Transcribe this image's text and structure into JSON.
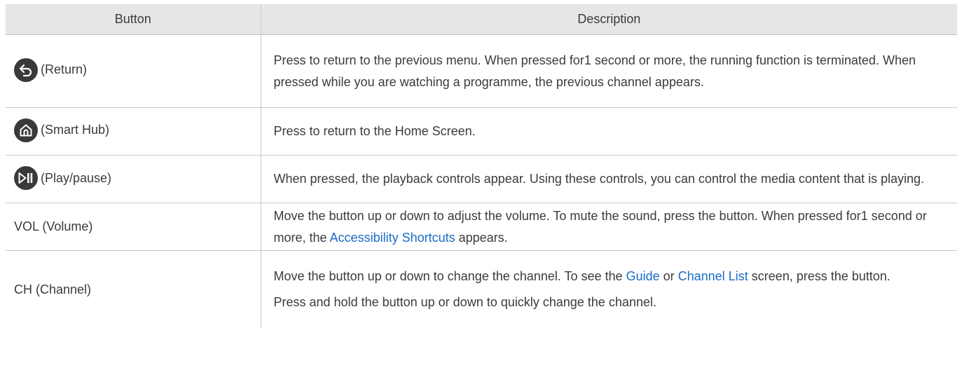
{
  "header": {
    "button": "Button",
    "description": "Description"
  },
  "rows": {
    "return": {
      "icon": "return-icon",
      "label": "(Return)",
      "desc": "Press to return to the previous menu. When pressed for1 second or more, the running function is terminated. When pressed while you are watching a programme, the previous channel appears."
    },
    "home": {
      "icon": "home-icon",
      "label": "(Smart Hub)",
      "desc": "Press to return to the Home Screen."
    },
    "play": {
      "icon": "play-pause-icon",
      "label": "(Play/pause)",
      "desc": "When pressed, the playback controls appear. Using these controls, you can control the media content that is playing."
    },
    "vol": {
      "label": "VOL (Volume)",
      "desc_a": "Move the button up or down to adjust the volume. To mute the sound, press the button. When pressed for1 second or more, the ",
      "link": "Accessibility Shortcuts",
      "desc_b": " appears."
    },
    "ch": {
      "label": "CH (Channel)",
      "desc_a": "Move the button up or down to change the channel. To see the ",
      "link1": "Guide",
      "desc_mid": " or ",
      "link2": "Channel List",
      "desc_b": " screen, press the button.",
      "desc2": "Press and hold the button up or down to quickly change the channel."
    }
  },
  "colors": {
    "header_bg": "#e6e6e6",
    "icon_bg": "#3a3a3a",
    "link": "#1a6bc4",
    "text": "#3b3b3b"
  }
}
